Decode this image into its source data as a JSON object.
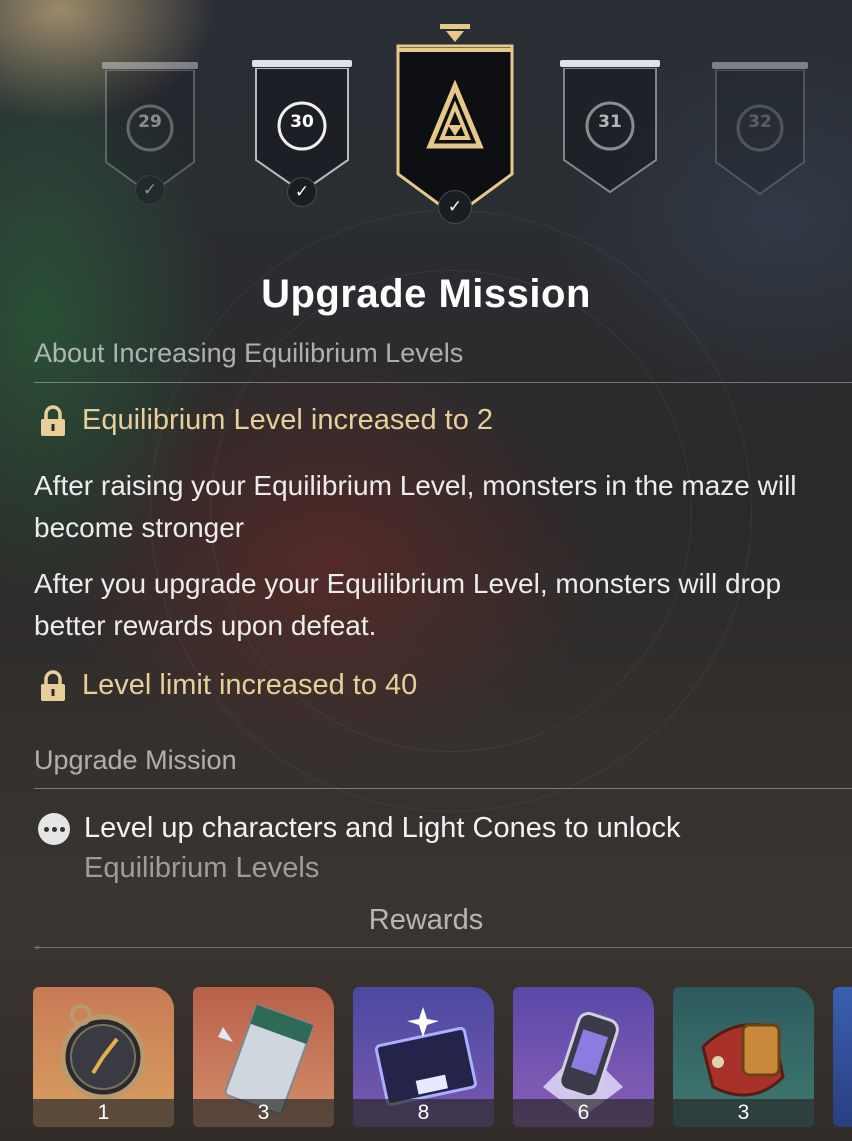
{
  "badges": [
    {
      "level": "29",
      "completed": true,
      "state": "past"
    },
    {
      "level": "30",
      "completed": true,
      "state": "past"
    },
    {
      "level": "",
      "completed": true,
      "state": "selected",
      "icon": "triangle-emblem-icon"
    },
    {
      "level": "31",
      "completed": false,
      "state": "upcoming"
    },
    {
      "level": "32",
      "completed": false,
      "state": "upcoming"
    }
  ],
  "title": "Upgrade Mission",
  "about": {
    "heading": "About Increasing Equilibrium Levels",
    "unlock1": "Equilibrium Level increased to 2",
    "para1": "After raising your Equilibrium Level, monsters in the maze will become stronger",
    "para2": "After you upgrade your Equilibrium Level, monsters will drop better rewards upon defeat.",
    "unlock2": "Level limit increased to 40"
  },
  "mission": {
    "heading": "Upgrade Mission",
    "text_line1": "Level up characters and Light Cones to unlock",
    "text_line2": "Equilibrium Levels"
  },
  "rewards": {
    "heading": "Rewards",
    "items": [
      {
        "icon": "pocket-watch-icon",
        "count": "1",
        "color": "#b5763f"
      },
      {
        "icon": "ticket-icon",
        "count": "3",
        "color": "#a86345"
      },
      {
        "icon": "book-icon",
        "count": "8",
        "color": "#5b4a9a"
      },
      {
        "icon": "canister-icon",
        "count": "6",
        "color": "#6a4f9e"
      },
      {
        "icon": "gauntlet-icon",
        "count": "3",
        "color": "#2f6a66"
      }
    ]
  },
  "colors": {
    "gold": "#e8cf9a",
    "badge_gold": "#e6c98a"
  }
}
